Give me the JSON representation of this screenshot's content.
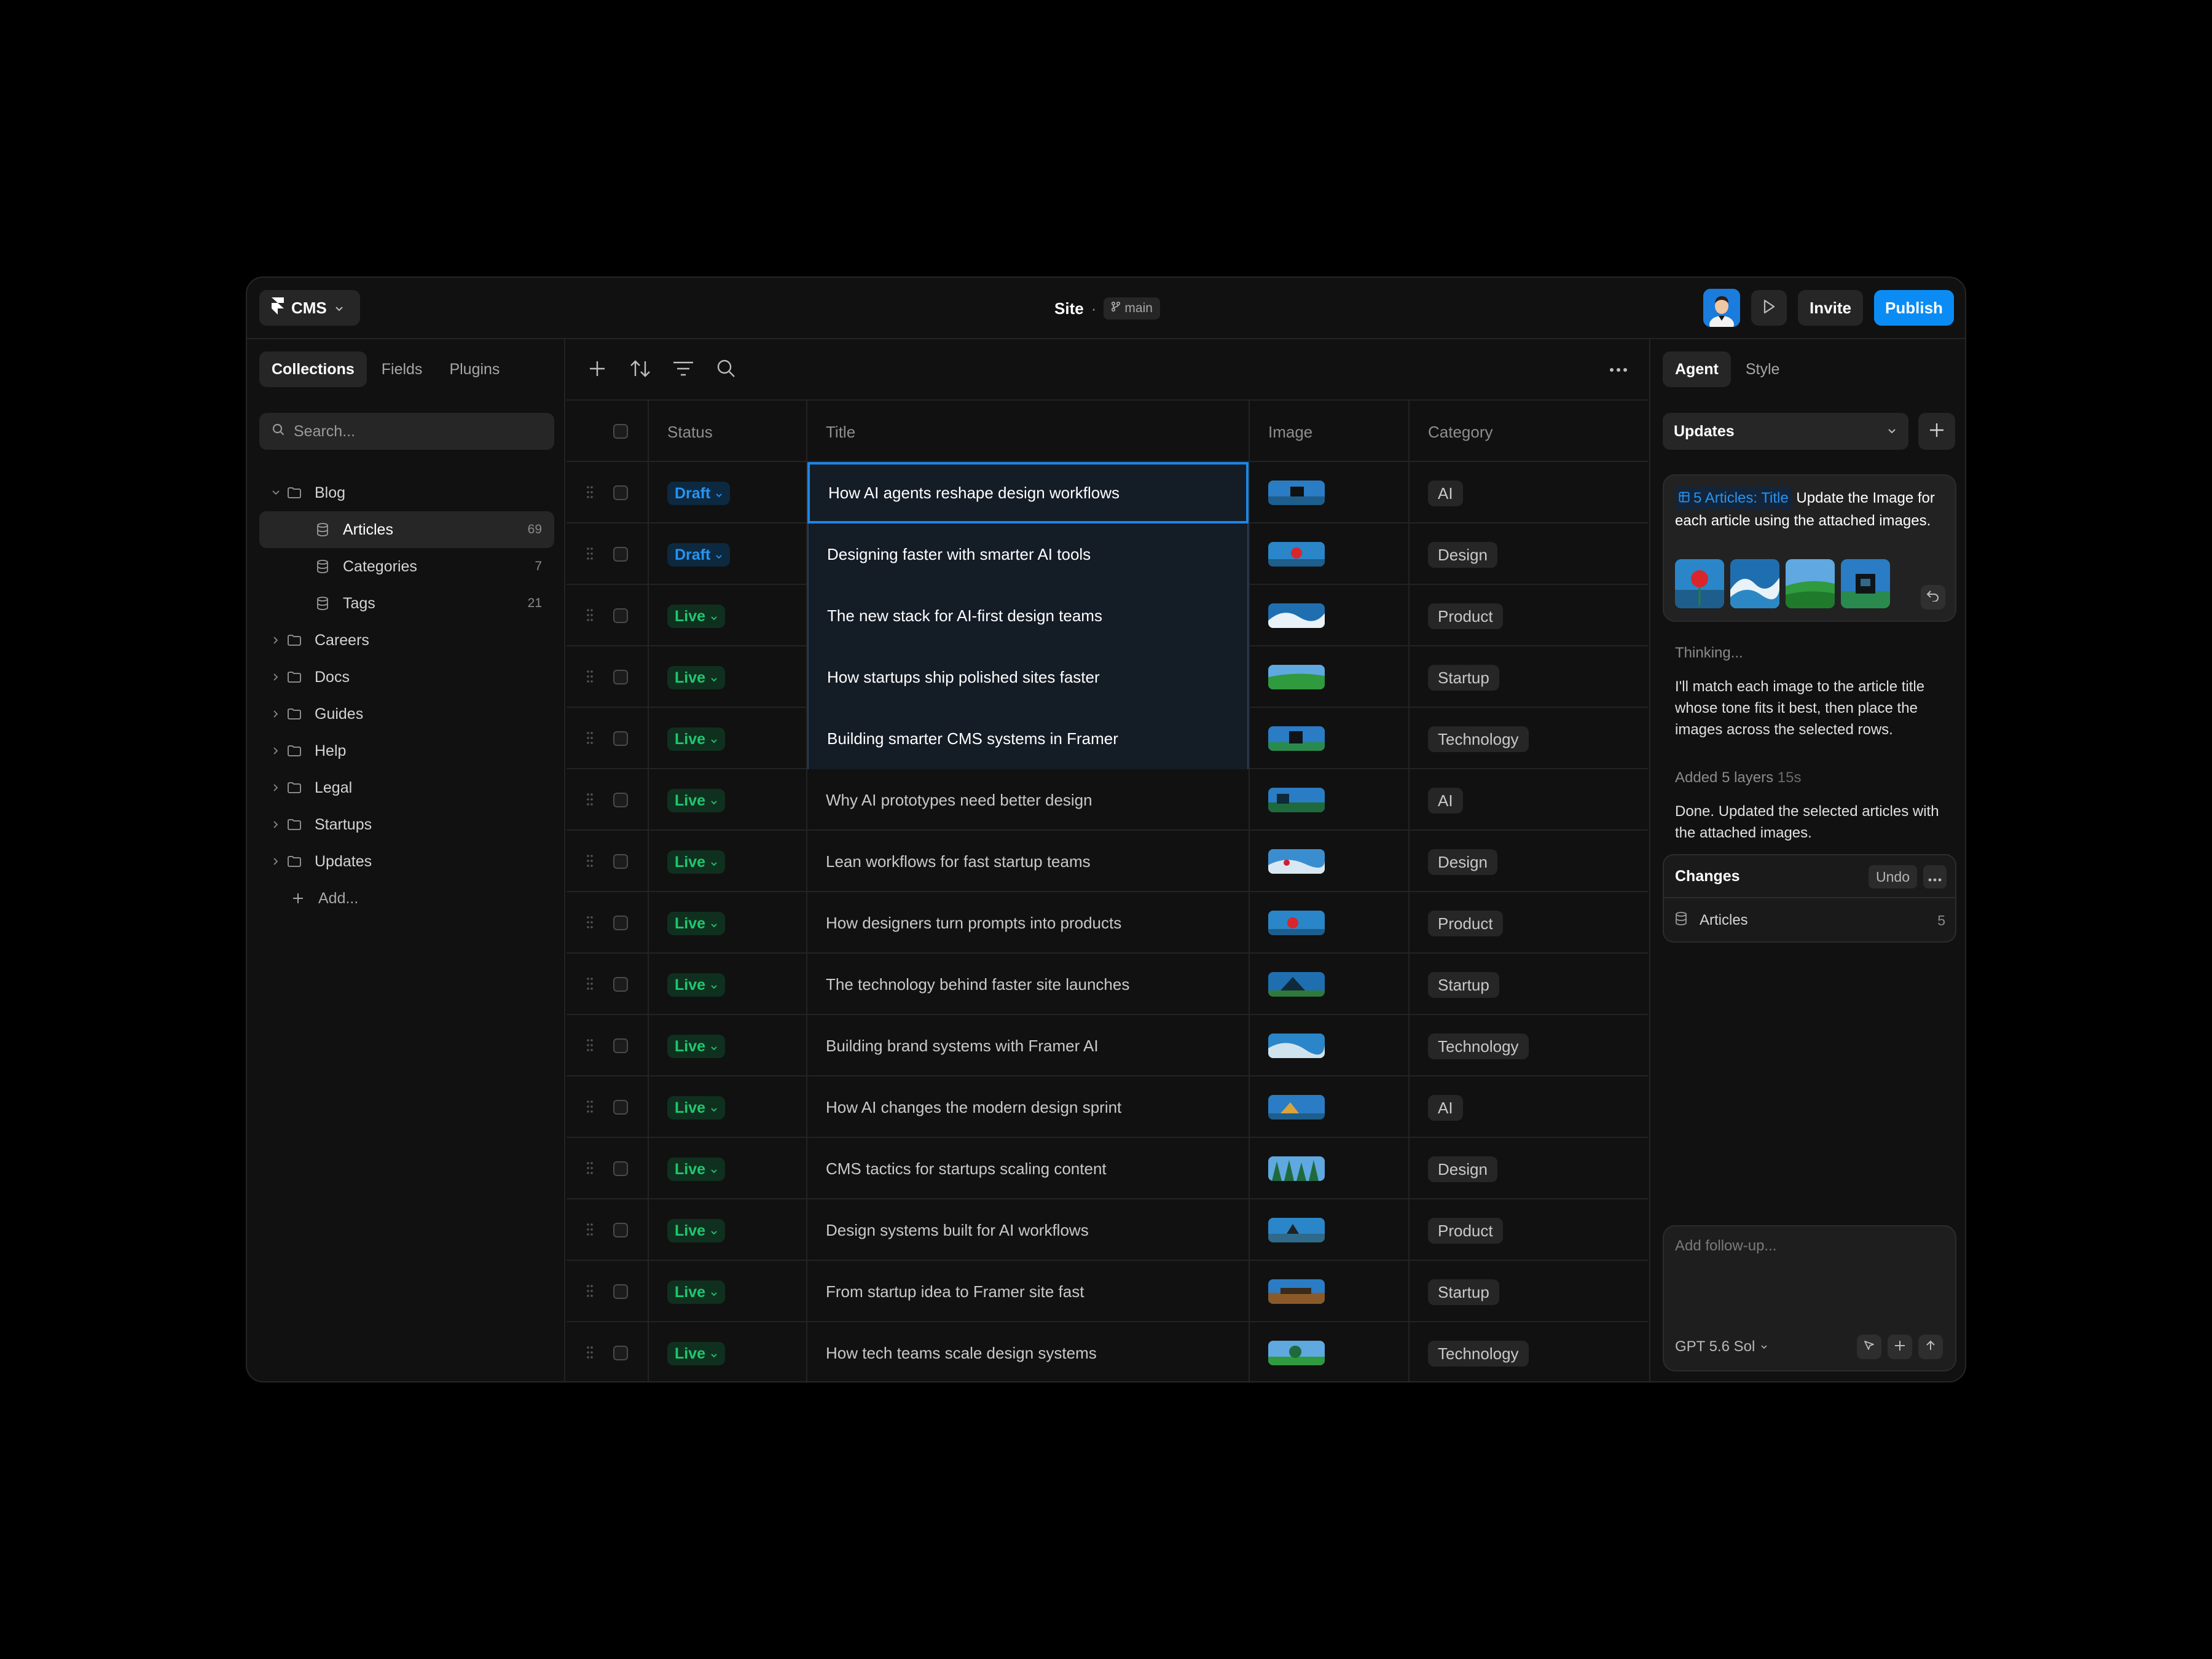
{
  "topbar": {
    "app_label": "CMS",
    "site_label": "Site",
    "separator": "·",
    "branch_label": "main",
    "invite_label": "Invite",
    "publish_label": "Publish",
    "publish_color": "#0a8cf4"
  },
  "sidebar": {
    "tabs": [
      "Collections",
      "Fields",
      "Plugins"
    ],
    "active_tab": "Collections",
    "search_placeholder": "Search...",
    "tree": [
      {
        "label": "Blog",
        "type": "folder",
        "expanded": true
      },
      {
        "label": "Articles",
        "type": "collection",
        "count": "69",
        "selected": true
      },
      {
        "label": "Categories",
        "type": "collection",
        "count": "7"
      },
      {
        "label": "Tags",
        "type": "collection",
        "count": "21"
      },
      {
        "label": "Careers",
        "type": "folder"
      },
      {
        "label": "Docs",
        "type": "folder"
      },
      {
        "label": "Guides",
        "type": "folder"
      },
      {
        "label": "Help",
        "type": "folder"
      },
      {
        "label": "Legal",
        "type": "folder"
      },
      {
        "label": "Startups",
        "type": "folder"
      },
      {
        "label": "Updates",
        "type": "folder"
      }
    ],
    "add_label": "Add..."
  },
  "table": {
    "columns": {
      "status": "Status",
      "title": "Title",
      "image": "Image",
      "category": "Category"
    },
    "rows": [
      {
        "status": "Draft",
        "title": "How AI agents reshape design workflows",
        "category": "AI",
        "selected": true,
        "focused": true
      },
      {
        "status": "Draft",
        "title": "Designing faster with smarter AI tools",
        "category": "Design",
        "selected": true
      },
      {
        "status": "Live",
        "title": "The new stack for AI-first design teams",
        "category": "Product",
        "selected": true
      },
      {
        "status": "Live",
        "title": "How startups ship polished sites faster",
        "category": "Startup",
        "selected": true
      },
      {
        "status": "Live",
        "title": "Building smarter CMS systems in Framer",
        "category": "Technology",
        "selected": true
      },
      {
        "status": "Live",
        "title": "Why AI prototypes need better design",
        "category": "AI"
      },
      {
        "status": "Live",
        "title": "Lean workflows for fast startup teams",
        "category": "Design"
      },
      {
        "status": "Live",
        "title": "How designers turn prompts into products",
        "category": "Product"
      },
      {
        "status": "Live",
        "title": "The technology behind faster site launches",
        "category": "Startup"
      },
      {
        "status": "Live",
        "title": "Building brand systems with Framer AI",
        "category": "Technology"
      },
      {
        "status": "Live",
        "title": "How AI changes the modern design sprint",
        "category": "AI"
      },
      {
        "status": "Live",
        "title": "CMS tactics for startups scaling content",
        "category": "Design"
      },
      {
        "status": "Live",
        "title": "Design systems built for AI workflows",
        "category": "Product"
      },
      {
        "status": "Live",
        "title": "From startup idea to Framer site fast",
        "category": "Startup"
      },
      {
        "status": "Live",
        "title": "How tech teams scale design systems",
        "category": "Technology"
      }
    ],
    "status_colors": {
      "Live": "#1fc86f",
      "Draft": "#2794f0"
    }
  },
  "agent": {
    "tabs": [
      "Agent",
      "Style"
    ],
    "active_tab": "Agent",
    "select_value": "Updates",
    "prompt_ref": "5 Articles: Title",
    "prompt_text": "Update the Image for each article using the attached images.",
    "thinking": "Thinking...",
    "message_1": "I'll match each image to the article title whose tone fits it best, then place the images across the selected rows.",
    "added_label": "Added 5 layers",
    "added_time": "15s",
    "message_2": "Done. Updated the selected articles with the attached images.",
    "changes_title": "Changes",
    "undo_label": "Undo",
    "changes_item": "Articles",
    "changes_count": "5",
    "followup_placeholder": "Add follow-up...",
    "model_label": "GPT 5.6 Sol"
  }
}
